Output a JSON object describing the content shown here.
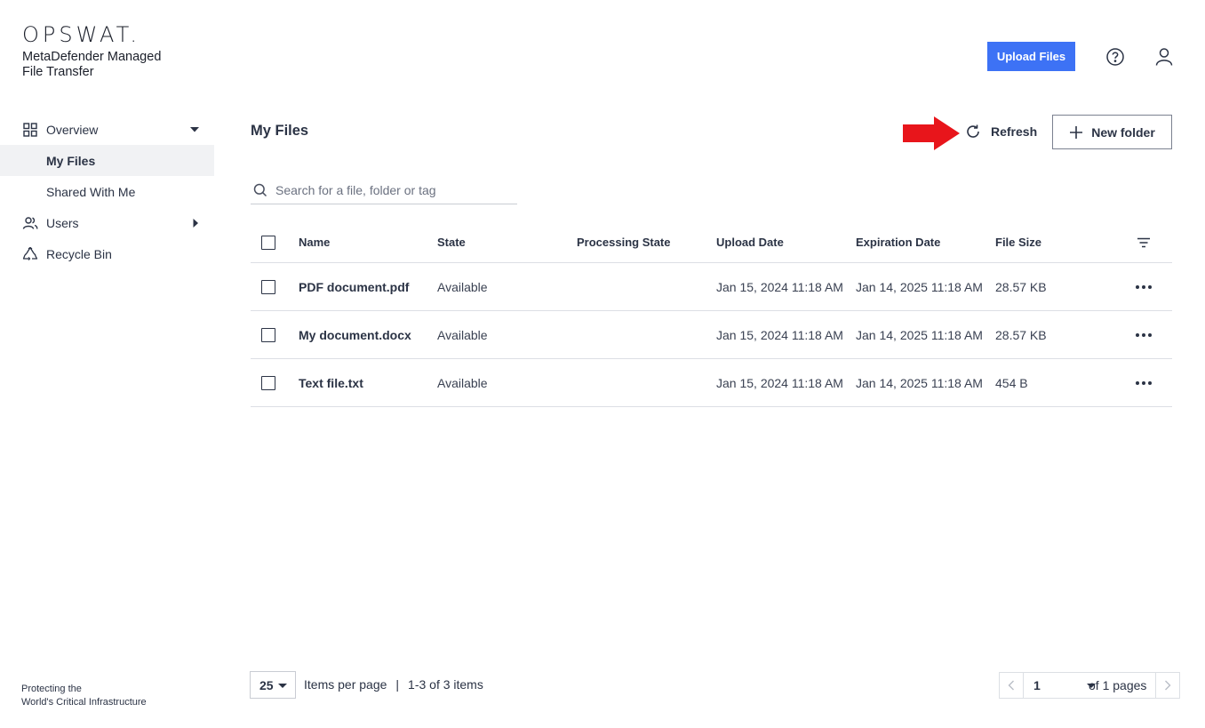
{
  "brand": {
    "wordmark": "OPSWAT.",
    "product": "MetaDefender Managed File Transfer",
    "tagline_line1": "Protecting the",
    "tagline_line2": "World's Critical Infrastructure"
  },
  "header": {
    "upload_label": "Upload Files",
    "accent": "#3d72f5"
  },
  "sidebar": {
    "items": [
      {
        "label": "Overview",
        "icon": "grid-icon"
      },
      {
        "label": "My Files"
      },
      {
        "label": "Shared With Me"
      },
      {
        "label": "Users",
        "icon": "users-icon"
      },
      {
        "label": "Recycle Bin",
        "icon": "recycle-icon"
      }
    ]
  },
  "main": {
    "title": "My Files",
    "refresh_label": "Refresh",
    "new_folder_label": "New folder",
    "search_placeholder": "Search for a file, folder or tag",
    "annotation_color": "#e8151b"
  },
  "table": {
    "columns": {
      "name": "Name",
      "state": "State",
      "processing": "Processing State",
      "upload": "Upload Date",
      "expiration": "Expiration Date",
      "size": "File Size"
    },
    "rows": [
      {
        "name": "PDF document.pdf",
        "state": "Available",
        "processing": "",
        "upload": "Jan 15, 2024 11:18 AM",
        "expiration": "Jan 14, 2025 11:18 AM",
        "size": "28.57 KB"
      },
      {
        "name": "My document.docx",
        "state": "Available",
        "processing": "",
        "upload": "Jan 15, 2024 11:18 AM",
        "expiration": "Jan 14, 2025 11:18 AM",
        "size": "28.57 KB"
      },
      {
        "name": "Text file.txt",
        "state": "Available",
        "processing": "",
        "upload": "Jan 15, 2024 11:18 AM",
        "expiration": "Jan 14, 2025 11:18 AM",
        "size": "454 B"
      }
    ]
  },
  "pagination": {
    "per_page": "25",
    "per_page_label": "Items per page",
    "separator": "|",
    "range_label": "1-3 of 3 items",
    "current_page": "1",
    "of_pages": "of 1 pages"
  }
}
